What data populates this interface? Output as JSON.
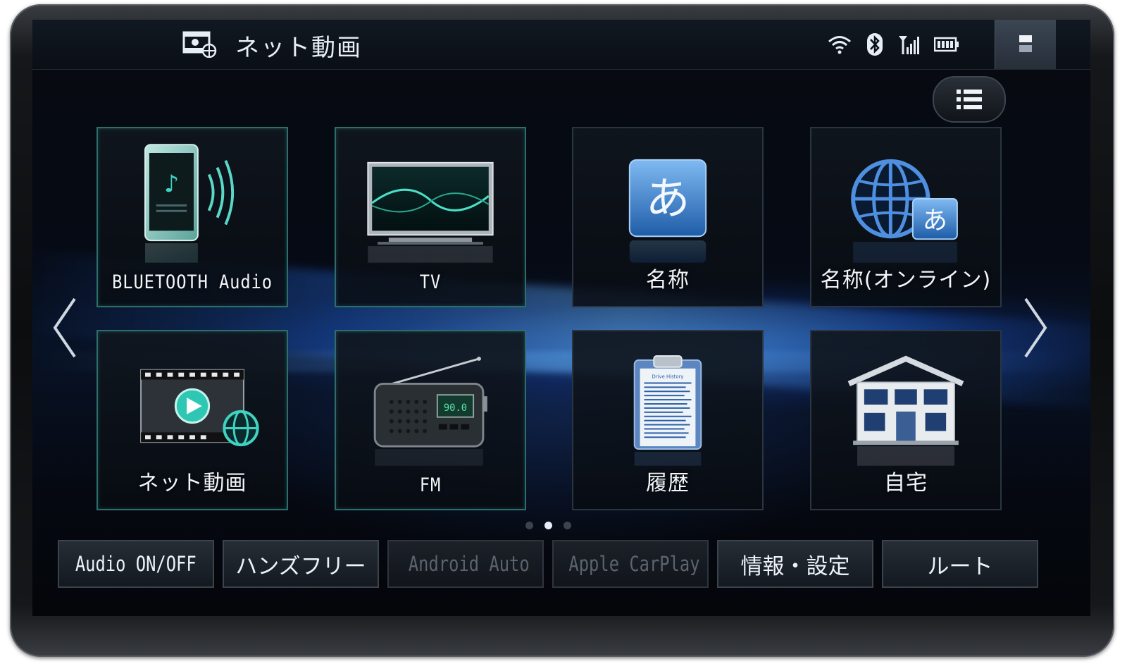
{
  "header": {
    "title": "ネット動画",
    "source_icon": "net-video-icon",
    "status_icons": [
      "wifi-icon",
      "bluetooth-icon",
      "signal-strength-icon",
      "battery-icon"
    ],
    "menu_icon": "display-toggle-icon"
  },
  "list_button": {
    "icon": "list-icon"
  },
  "tiles": [
    {
      "label": "BLUETOOTH Audio",
      "icon": "bluetooth-audio-phone-icon"
    },
    {
      "label": "TV",
      "icon": "tv-icon"
    },
    {
      "label": "名称",
      "icon": "name-search-icon",
      "glyph": "あ"
    },
    {
      "label": "名称(オンライン)",
      "icon": "online-name-search-icon",
      "glyph": "あ"
    },
    {
      "label": "ネット動画",
      "icon": "net-video-tile-icon"
    },
    {
      "label": "FM",
      "icon": "fm-radio-icon",
      "display": "90.0"
    },
    {
      "label": "履歴",
      "icon": "history-clipboard-icon",
      "clipboard_title": "Drive History"
    },
    {
      "label": "自宅",
      "icon": "home-house-icon"
    }
  ],
  "navigation": {
    "prev": "chevron-left-icon",
    "next": "chevron-right-icon"
  },
  "pager": {
    "pages": 3,
    "current": 2
  },
  "bottom_buttons": [
    {
      "label": "Audio ON/OFF",
      "enabled": true
    },
    {
      "label": "ハンズフリー",
      "enabled": true
    },
    {
      "label": "Android Auto",
      "enabled": false,
      "icon": "android-auto-icon"
    },
    {
      "label": "Apple CarPlay",
      "enabled": false,
      "icon": "carplay-icon"
    },
    {
      "label": "情報・設定",
      "enabled": true
    },
    {
      "label": "ルート",
      "enabled": true
    }
  ],
  "colors": {
    "accent_teal": "#2b6e6a",
    "glow_blue": "#3c8cff"
  }
}
